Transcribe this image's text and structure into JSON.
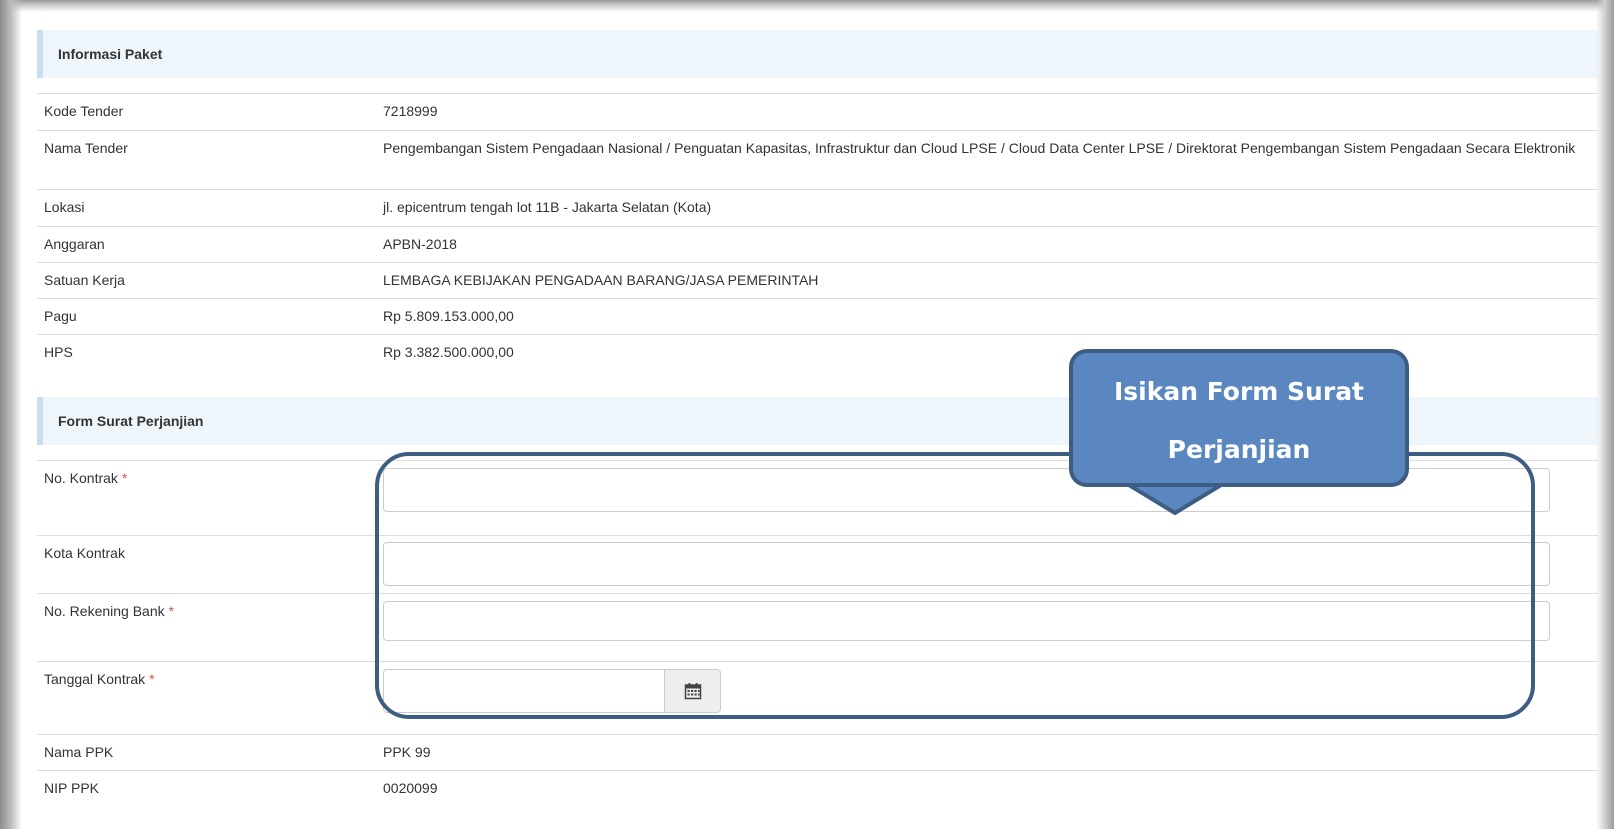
{
  "info_section": {
    "title": "Informasi Paket"
  },
  "info_rows": [
    {
      "label": "Kode Tender",
      "value": "7218999"
    },
    {
      "label": "Nama Tender",
      "value": "Pengembangan Sistem Pengadaan Nasional / Penguatan Kapasitas, Infrastruktur dan Cloud LPSE / Cloud Data Center LPSE / Direktorat Pengembangan Sistem Pengadaan Secara Elektronik"
    },
    {
      "label": "Lokasi",
      "value": "jl. epicentrum tengah lot 11B - Jakarta Selatan (Kota)"
    },
    {
      "label": "Anggaran",
      "value": "APBN-2018"
    },
    {
      "label": "Satuan Kerja",
      "value": "LEMBAGA KEBIJAKAN PENGADAAN BARANG/JASA PEMERINTAH"
    },
    {
      "label": "Pagu",
      "value": "Rp 5.809.153.000,00"
    },
    {
      "label": "HPS",
      "value": "Rp 3.382.500.000,00"
    }
  ],
  "form_section": {
    "title": "Form Surat Perjanjian"
  },
  "form_fields": {
    "no_kontrak": {
      "label": "No. Kontrak",
      "required_mark": "*",
      "value": ""
    },
    "kota_kontrak": {
      "label": "Kota Kontrak",
      "value": ""
    },
    "no_rekening": {
      "label": "No. Rekening Bank",
      "required_mark": "*",
      "value": ""
    },
    "tanggal_kontrak": {
      "label": "Tanggal Kontrak",
      "required_mark": "*",
      "value": ""
    }
  },
  "ppk_rows": [
    {
      "label": "Nama PPK",
      "value": "PPK 99"
    },
    {
      "label": "NIP PPK",
      "value": "0020099"
    }
  ],
  "callout": {
    "line1": "Isikan Form Surat",
    "line2": "Perjanjian"
  },
  "icons": {
    "calendar": "calendar-icon"
  },
  "colors": {
    "callout_fill": "#5b87c0",
    "callout_border": "#3e5d82",
    "required": "#d9534f",
    "section_bg": "#eef5fb"
  }
}
